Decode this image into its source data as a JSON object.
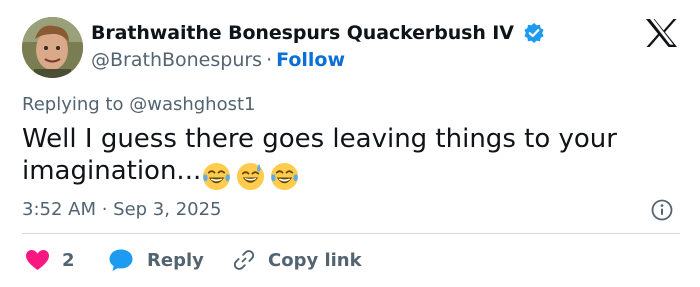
{
  "author": {
    "display_name": "Brathwaithe Bonespurs Quackerbush IV",
    "handle": "@BrathBonespurs",
    "separator": "·",
    "follow_label": "Follow",
    "verified": true,
    "avatar_icon": "profile-photo"
  },
  "brand": {
    "logo_icon": "x-logo"
  },
  "reply_context": {
    "prefix": "Replying to",
    "mention": "@washghost1"
  },
  "tweet": {
    "text_line1": "Well I guess there goes leaving things to your",
    "text_line2": "imagination...",
    "emojis": [
      "tears-of-joy-emoji",
      "sweat-smile-emoji",
      "tears-of-joy-emoji"
    ]
  },
  "meta": {
    "timestamp": "3:52 AM · Sep 3, 2025",
    "info_icon": "info-icon"
  },
  "actions": {
    "like_count": "2",
    "reply_label": "Reply",
    "copy_label": "Copy link"
  },
  "colors": {
    "text_primary": "#0f1419",
    "text_secondary": "#536471",
    "link_blue": "#0a6fd6",
    "like_pink": "#f91880",
    "reply_blue": "#1d9bf0",
    "verified_blue": "#1d9bf0",
    "divider": "#cfd9de"
  }
}
